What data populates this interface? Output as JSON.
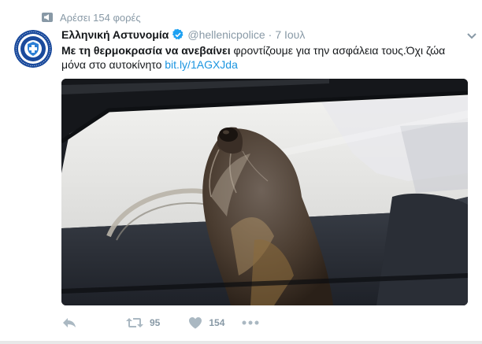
{
  "context": {
    "icon": "megaphone-icon",
    "text": "Αρέσει 154 φορές"
  },
  "tweet": {
    "author_name": "Ελληνική Αστυνομία",
    "verified_icon": "verified-badge-icon",
    "handle": "@hellenicpolice",
    "separator": "·",
    "time": "7 Ιουλ",
    "text_strong": "Με τη θερμοκρασία να ανεβαίνει",
    "text_line1_rest": " φροντίζουμε για την ασφάλεια τους.Όχι ζώα",
    "text_line2": "μόνα στο αυτοκίνητο ",
    "link": "bit.ly/1AGXJda",
    "media_alt_icon": "dog-in-car-photo"
  },
  "actions": {
    "reply_icon": "reply-icon",
    "retweet_icon": "retweet-icon",
    "retweet_count": "95",
    "like_icon": "heart-icon",
    "like_count": "154",
    "more_icon": "more-dots-icon"
  },
  "colors": {
    "text": "#14171a",
    "muted": "#8899a6",
    "link": "#1b95e0",
    "verified": "#1da1f2"
  }
}
